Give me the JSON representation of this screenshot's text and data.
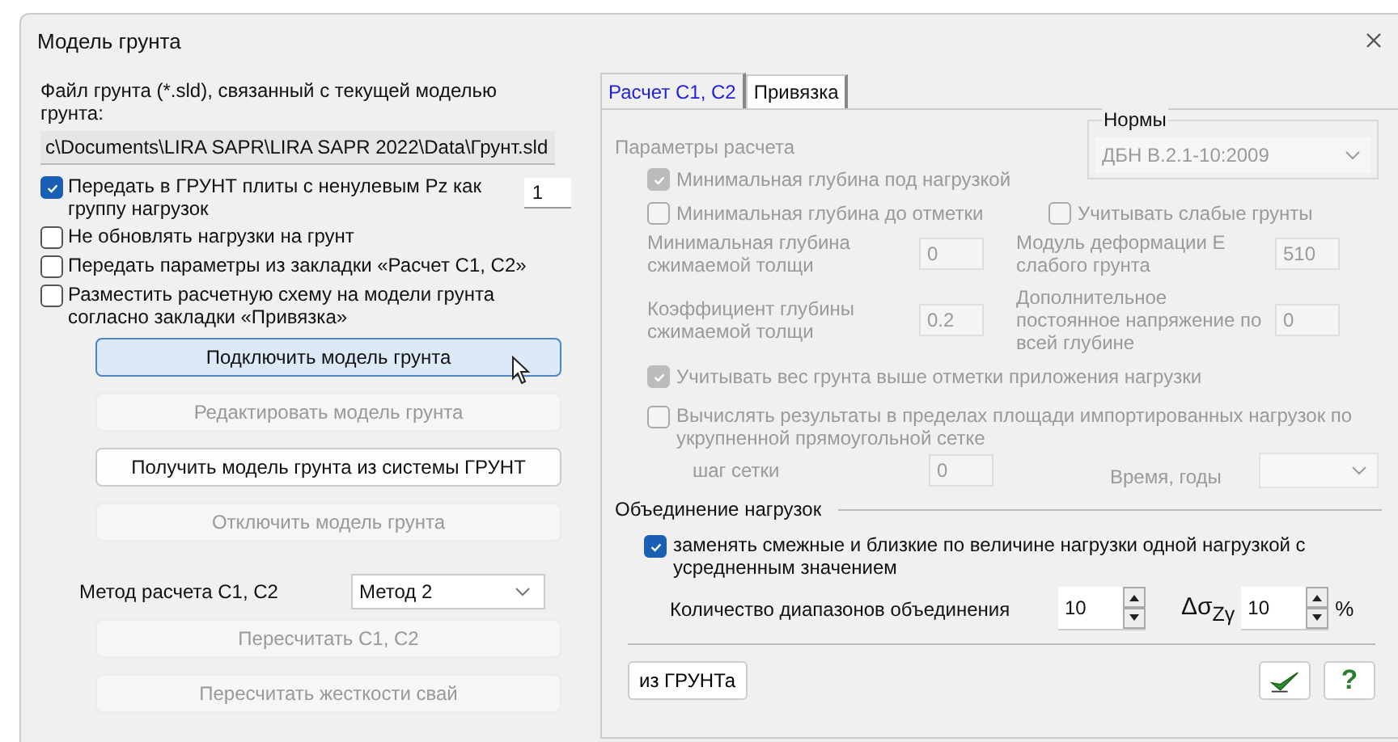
{
  "window": {
    "title": "Модель грунта"
  },
  "left": {
    "file_label": "Файл грунта (*.sld), связанный с текущей моделью грунта:",
    "file_path": "c\\Documents\\LIRA SAPR\\LIRA SAPR 2022\\Data\\Грунт.sld",
    "options": [
      {
        "label": "Передать в ГРУНТ плиты с ненулевым Pz как группу нагрузок",
        "checked": true,
        "value": "1"
      },
      {
        "label": "Не обновлять нагрузки на грунт",
        "checked": false
      },
      {
        "label": "Передать параметры из закладки «Расчет С1, С2»",
        "checked": false
      },
      {
        "label": "Разместить расчетную схему на модели грунта согласно закладки «Привязка»",
        "checked": false
      }
    ],
    "buttons": [
      {
        "label": "Подключить модель грунта",
        "disabled": false,
        "hovered": true
      },
      {
        "label": "Редактировать модель грунта",
        "disabled": true,
        "hovered": false
      },
      {
        "label": "Получить модель грунта из системы ГРУНТ",
        "disabled": false,
        "hovered": false
      },
      {
        "label": "Отключить модель грунта",
        "disabled": true,
        "hovered": false
      }
    ],
    "method": {
      "label": "Метод расчета С1, С2",
      "value": "Метод 2"
    },
    "recalc_buttons": [
      {
        "label": "Пересчитать С1, С2",
        "disabled": true
      },
      {
        "label": "Пересчитать жесткости свай",
        "disabled": true
      }
    ]
  },
  "tabs": [
    {
      "label": "Расчет С1, С2",
      "selected": true
    },
    {
      "label": "Привязка",
      "selected": false
    }
  ],
  "calc": {
    "title": "Параметры расчета",
    "disabled": true,
    "norms": {
      "label": "Нормы",
      "value": "ДБН В.2.1-10:2009"
    },
    "check_under_load": {
      "label": "Минимальная глубина под нагрузкой",
      "checked": true
    },
    "check_to_mark": {
      "label": "Минимальная глубина до отметки",
      "checked": false
    },
    "check_weak": {
      "label": "Учитывать слабые грунты",
      "checked": false
    },
    "fields": [
      {
        "label": "Минимальная глубина сжимаемой толщи",
        "value": "0"
      },
      {
        "label": "Модуль деформации Е слабого грунта",
        "value": "510"
      },
      {
        "label": "Коэффициент глубины сжимаемой толщи",
        "value": "0.2"
      },
      {
        "label": "Дополнительное постоянное напряжение по всей глубине",
        "value": "0"
      }
    ],
    "check_weight": {
      "label": "Учитывать вес грунта выше отметки приложения нагрузки",
      "checked": true
    },
    "check_area": {
      "label": "Вычислять результаты в пределах площади импортированных нагрузок по укрупненной прямоугольной сетке",
      "checked": false
    },
    "grid_step": {
      "label": "шаг сетки",
      "value": "0"
    },
    "time": {
      "label": "Время, годы"
    }
  },
  "merge": {
    "title": "Объединение нагрузок",
    "replace": {
      "label": "заменять смежные и близкие по величине нагрузки одной нагрузкой с усредненным значением",
      "checked": true
    },
    "count": {
      "label": "Количество диапазонов объединения",
      "value": "10"
    },
    "delta": {
      "label": "Δσ$_{Zγ}$",
      "value": "10",
      "unit": "%"
    }
  },
  "footer": {
    "import_button": "из ГРУНТа",
    "help": "?"
  }
}
